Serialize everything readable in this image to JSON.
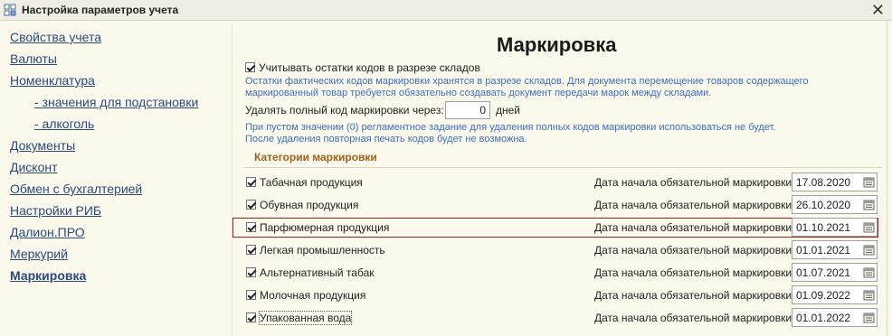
{
  "window": {
    "title": "Настройка параметров учета",
    "close_glyph": "✕"
  },
  "sidebar": {
    "items": [
      {
        "label": "Свойства учета"
      },
      {
        "label": "Валюты"
      },
      {
        "label": "Номенклатура"
      },
      {
        "label": "- значения для подстановки"
      },
      {
        "label": "- алкоголь"
      },
      {
        "label": "Документы"
      },
      {
        "label": "Дисконт"
      },
      {
        "label": "Обмен с бухгалтерией"
      },
      {
        "label": "Настройки РИБ"
      },
      {
        "label": "Далион.ПРО"
      },
      {
        "label": "Меркурий"
      },
      {
        "label": "Маркировка"
      }
    ],
    "active_index": 11
  },
  "main": {
    "title": "Маркировка",
    "warehouse_checkbox": {
      "label": "Учитывать остатки кодов в разрезе складов",
      "checked": true,
      "hint_lines": [
        "Остатки фактических кодов маркировки хранятся в разрезе складов. Для документа перемещение товаров содержащего",
        "маркированный товар требуется обязательно создавать документ передачи марок между складами."
      ]
    },
    "delete_code": {
      "label": "Удалять полный код маркировки через:",
      "value": "0",
      "unit": "дней",
      "hint_lines": [
        "При пустом значении (0) регламентное задание для удаления полных кодов маркировки использоваться не будет.",
        "После удаления повторная печать кодов будет не возможна."
      ]
    },
    "categories_title": "Категории маркировки",
    "date_label": "Дата начала обязательной маркировки:",
    "categories": [
      {
        "name": "Табачная продукция",
        "checked": true,
        "date": "17.08.2020"
      },
      {
        "name": "Обувная продукция",
        "checked": true,
        "date": "26.10.2020"
      },
      {
        "name": "Парфюмерная продукция",
        "checked": true,
        "date": "01.10.2021",
        "highlighted": true
      },
      {
        "name": "Легкая промышленность",
        "checked": true,
        "date": "01.01.2021"
      },
      {
        "name": "Альтернативный табак",
        "checked": true,
        "date": "01.07.2021"
      },
      {
        "name": "Молочная продукция",
        "checked": true,
        "date": "01.09.2022"
      },
      {
        "name": "Упакованная вода",
        "checked": true,
        "date": "01.01.2022"
      }
    ]
  },
  "colors": {
    "background": "#fbf8ec",
    "link": "#2b4a7b",
    "hint": "#3d6fc1",
    "section_title": "#a25f1b",
    "highlight_border": "#b01e1e"
  },
  "icons": {
    "app": "settings-form-icon",
    "close": "close-icon",
    "calendar": "calendar-icon"
  }
}
